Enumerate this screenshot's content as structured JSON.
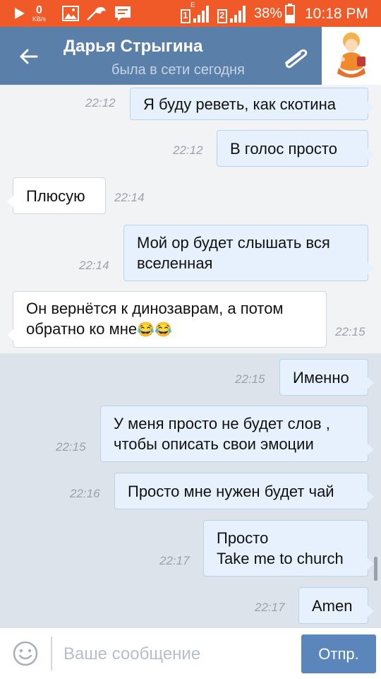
{
  "status_bar": {
    "network_speed": "0",
    "network_unit": "KB/s",
    "sim1_label": "1",
    "sim1_network": "E",
    "sim2_label": "2",
    "battery": "38%",
    "time": "10:18 PM",
    "bg_color": "#f05a28"
  },
  "header": {
    "back_icon": "arrow-left-icon",
    "title": "Дарья Стрыгина",
    "subtitle": "была в сети сегодня",
    "attach_icon": "paperclip-icon",
    "avatar_icon": "avatar-image",
    "bg_color": "#5a80aa"
  },
  "messages": [
    {
      "direction": "out",
      "lines": [
        "Я буду реветь, как скотина"
      ],
      "time": "22:12"
    },
    {
      "direction": "out",
      "lines": [
        "В  голос просто"
      ],
      "time": "22:12"
    },
    {
      "direction": "in",
      "lines": [
        "Плюсую"
      ],
      "time": "22:14"
    },
    {
      "direction": "out",
      "lines": [
        "Мой ор будет слышать вся",
        "вселенная"
      ],
      "time": "22:14"
    },
    {
      "direction": "in",
      "lines": [
        "Он вернётся к динозаврам, а потом",
        "обратно ко мне"
      ],
      "emoji": "😂😂",
      "emoji_icon": "tears-of-joy-emoji",
      "time": "22:15"
    },
    {
      "direction": "out",
      "lines": [
        "Именно"
      ],
      "time": "22:15"
    },
    {
      "direction": "out",
      "lines": [
        "У меня просто не будет слов ,",
        "чтобы описать свои  эмоции"
      ],
      "time": "22:15"
    },
    {
      "direction": "out",
      "lines": [
        "Просто мне нужен будет чай"
      ],
      "time": "22:16"
    },
    {
      "direction": "out",
      "lines": [
        "Просто",
        "Take me to church"
      ],
      "time": "22:17"
    },
    {
      "direction": "out",
      "lines": [
        "Amen"
      ],
      "time": "22:17"
    }
  ],
  "composer": {
    "emoji_icon": "smiley-icon",
    "placeholder": "Ваше сообщение",
    "value": "",
    "send_label": "Отпр.",
    "send_color": "#5b86bb"
  }
}
